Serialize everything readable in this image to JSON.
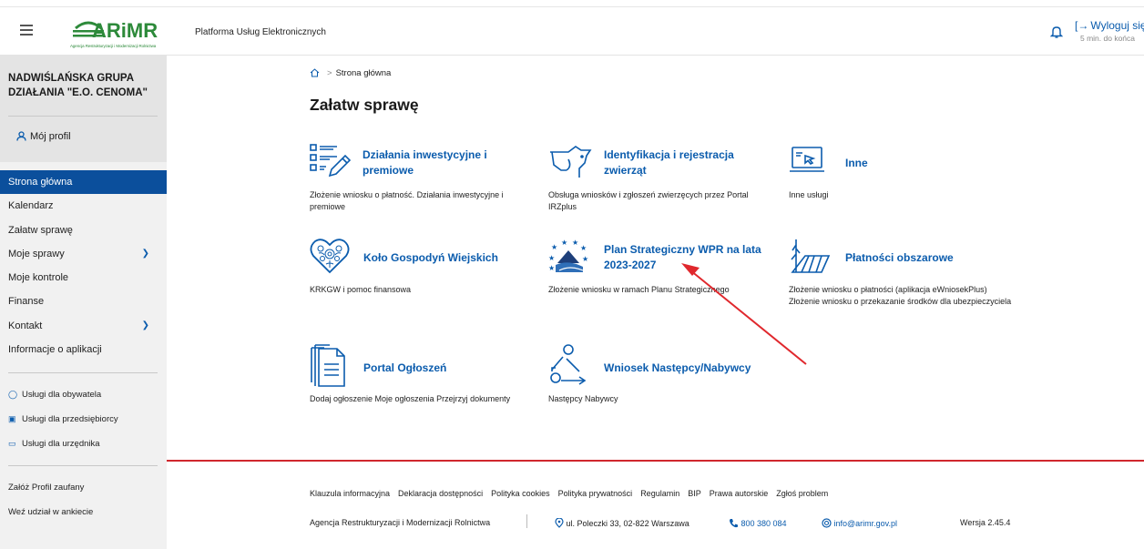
{
  "header": {
    "logo_text": "ARiMR",
    "logo_subtext": "Agencja Restrukturyzacji i Modernizacji Rolnictwa",
    "platform_title": "Platforma Usług Elektronicznych",
    "logout_label": "Wyloguj się",
    "session_timeout": "5 min. do końca",
    "accent_color": "#0b5cad",
    "brand_green": "#2d8a3a"
  },
  "sidebar": {
    "org_name": "NADWIŚLAŃSKA GRUPA DZIAŁANIA \"E.O. CENOMA\"",
    "profile_label": "Mój profil",
    "items": [
      {
        "label": "Strona główna",
        "active": true
      },
      {
        "label": "Kalendarz"
      },
      {
        "label": "Załatw sprawę"
      },
      {
        "label": "Moje sprawy",
        "expandable": true
      },
      {
        "label": "Moje kontrole"
      },
      {
        "label": "Finanse"
      },
      {
        "label": "Kontakt",
        "expandable": true
      },
      {
        "label": "Informacje o aplikacji"
      }
    ],
    "services": [
      {
        "label": "Usługi dla obywatela",
        "icon": "person-icon"
      },
      {
        "label": "Usługi dla przedsiębiorcy",
        "icon": "briefcase-icon"
      },
      {
        "label": "Usługi dla urzędnika",
        "icon": "monitor-icon"
      }
    ],
    "bottom_links": [
      "Załóż Profil zaufany",
      "Weź udział w ankiecie"
    ]
  },
  "main": {
    "breadcrumb": "Strona główna",
    "title": "Załatw sprawę",
    "tiles": [
      {
        "name": "Działania inwestycyjne i premiowe",
        "desc": "Złożenie wniosku o płatność. Działania inwestycyjne i premiowe",
        "icon": "form-pencil-icon"
      },
      {
        "name": "Identyfikacja i rejestracja zwierząt",
        "desc": "Obsługa wniosków i zgłoszeń zwierzęcych przez Portal IRZplus",
        "icon": "cow-icon"
      },
      {
        "name": "Inne",
        "desc": "Inne usługi",
        "icon": "laptop-icon"
      },
      {
        "name": "Koło Gospodyń Wiejskich",
        "desc": "KRKGW i pomoc finansowa",
        "icon": "folk-heart-icon"
      },
      {
        "name": "Plan Strategiczny WPR na lata 2023-2027",
        "desc": "Złożenie wniosku w ramach Planu Strategicznego",
        "icon": "eu-stars-icon"
      },
      {
        "name": "Płatności obszarowe",
        "desc": "Złożenie wniosku o płatności (aplikacja eWniosekPlus)\nZłożenie wniosku o przekazanie środków dla ubezpieczyciela",
        "icon": "field-icon"
      },
      {
        "name": "Portal Ogłoszeń",
        "desc": "Dodaj ogłoszenie Moje ogłoszenia Przejrzyj dokumenty",
        "icon": "documents-icon"
      },
      {
        "name": "Wniosek Następcy/Nabywcy",
        "desc": "Następcy Nabywcy",
        "icon": "successor-icon"
      }
    ]
  },
  "footer": {
    "links": [
      "Klauzula informacyjna",
      "Deklaracja dostępności",
      "Polityka cookies",
      "Polityka prywatności",
      "Regulamin",
      "BIP",
      "Prawa autorskie",
      "Zgłoś problem"
    ],
    "agency": "Agencja Restrukturyzacji i Modernizacji Rolnictwa",
    "address": "ul. Poleczki 33, 02-822 Warszawa",
    "phone": "800 380 084",
    "email": "info@arimr.gov.pl",
    "version": "Wersja 2.45.4"
  }
}
